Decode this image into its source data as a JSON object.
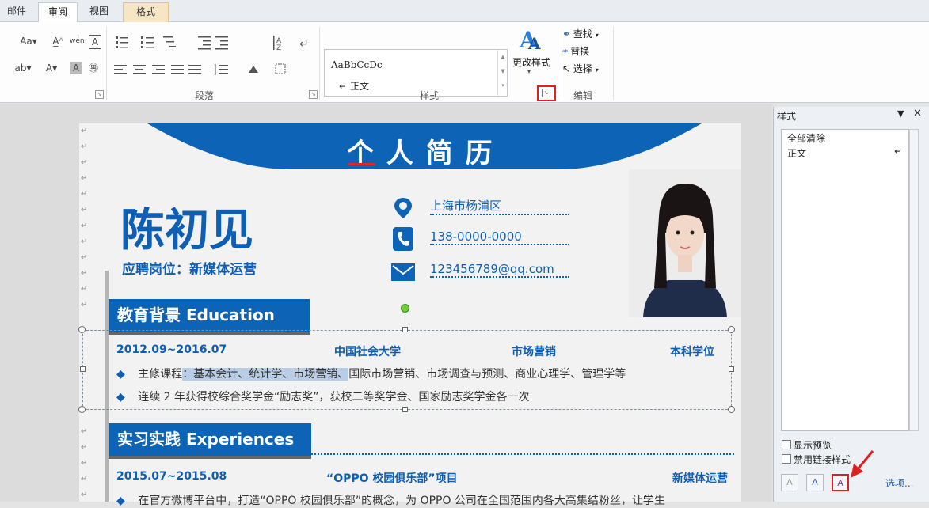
{
  "tabs": [
    {
      "label": "邮件"
    },
    {
      "label": "审阅",
      "active": true
    },
    {
      "label": "视图"
    },
    {
      "label": "格式",
      "context": true
    }
  ],
  "ribbon": {
    "font_icons": [
      "Aa▾",
      "A̲ᴬ",
      "wén",
      "A",
      "ab▾",
      "A▾",
      "A",
      "㊚"
    ],
    "paragraph_label": "段落",
    "styles_label": "样式",
    "editing_label": "编辑",
    "gallery": {
      "sample": "AaBbCcDc",
      "name": "↵ 正文"
    },
    "change_styles": "更改样式",
    "find": "查找",
    "replace": "替换",
    "select": "选择"
  },
  "resume": {
    "title": "个 人 简 历",
    "name": "陈初见",
    "position": "应聘岗位：新媒体运营",
    "contact": {
      "location": "上海市杨浦区",
      "phone": "138-0000-0000",
      "email": "123456789@qq.com"
    },
    "edu": {
      "header": "教育背景 Education",
      "period": "2012.09~2016.07",
      "school": "中国社会大学",
      "major": "市场营销",
      "degree": "本科学位",
      "b1_prefix": "主修课程",
      "b1_selected": "：基本会计、统计学、市场营销、",
      "b1_rest": "国际市场营销、市场调查与预测、商业心理学、管理学等",
      "b2": "连续 2 年获得校综合奖学金“励志奖”，获校二等奖学金、国家励志奖学金各一次"
    },
    "exp": {
      "header": "实习实践 Experiences",
      "period": "2015.07~2015.08",
      "project": "“OPPO 校园俱乐部”项目",
      "role": "新媒体运营",
      "b1": "在官方微博平台中，打造“OPPO 校园俱乐部”的概念，为 OPPO 公司在全国范围内各大高集结粉丝，让学生"
    }
  },
  "styles_pane": {
    "title": "样式",
    "items": [
      "全部清除",
      "正文"
    ],
    "show_preview": "显示预览",
    "disable_linked": "禁用链接样式",
    "options": "选项..."
  }
}
